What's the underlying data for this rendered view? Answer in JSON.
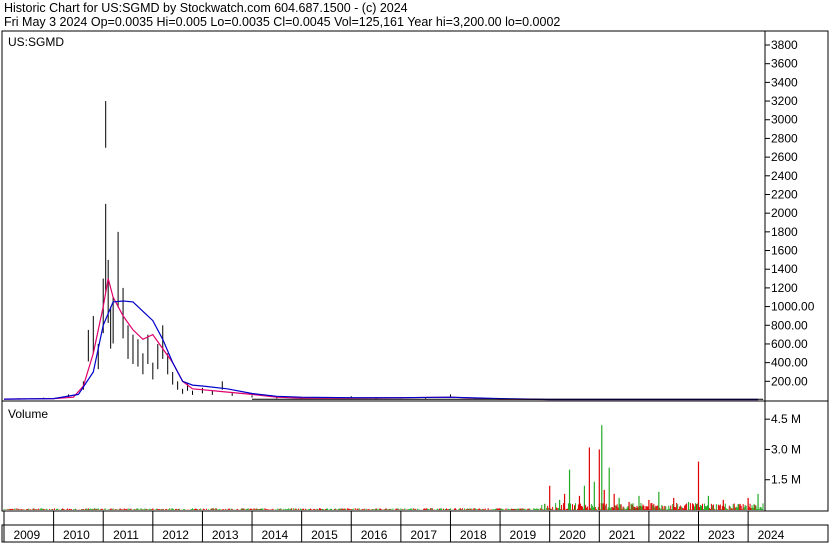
{
  "header": {
    "line1": "Historic Chart for US:SGMD by Stockwatch.com 604.687.1500 - (c) 2024",
    "line2": "Fri May  3 2024   Op=0.0035   Hi=0.005   Lo=0.0035   Cl=0.0045   Vol=125,161   Year hi=3,200.00   lo=0.0002"
  },
  "colors": {
    "price_bar": "#000000",
    "ma_short": "#e0006c",
    "ma_long": "#0000cc",
    "vol_up": "#22aa22",
    "vol_down": "#dd0000",
    "grid": "#000000"
  },
  "chart_data": [
    {
      "type": "line",
      "title": "US:SGMD",
      "ylim": [
        0,
        3950
      ],
      "y_ticks": [
        "3800",
        "3600",
        "3400",
        "3200",
        "3000",
        "2800",
        "2600",
        "2400",
        "2200",
        "2000",
        "1800",
        "1600",
        "1400",
        "1200",
        "1000.00",
        "800.00",
        "600.00",
        "400.00",
        "200.00"
      ],
      "x_ticks": [
        "2009",
        "2010",
        "2011",
        "2012",
        "2013",
        "2014",
        "2015",
        "2016",
        "2017",
        "2018",
        "2019",
        "2020",
        "2021",
        "2022",
        "2023",
        "2024"
      ],
      "grid": false,
      "series": [
        {
          "kind": "price",
          "x": [
            2008.8,
            2009.3,
            2009.8,
            2010.3,
            2010.6,
            2010.7,
            2010.8,
            2010.9,
            2011.0,
            2011.05,
            2011.1,
            2011.15,
            2011.2,
            2011.3,
            2011.4,
            2011.5,
            2011.6,
            2011.7,
            2011.8,
            2011.9,
            2012.0,
            2012.1,
            2012.2,
            2012.3,
            2012.4,
            2012.5,
            2012.6,
            2012.7,
            2012.8,
            2013.0,
            2013.2,
            2013.4,
            2013.6,
            2014.0,
            2014.5,
            2015.0,
            2016.0,
            2016.5,
            2017.0,
            2017.5,
            2018.0,
            2018.5,
            2019.0,
            2020.0,
            2021.0,
            2022.0,
            2023.0,
            2024.3
          ],
          "y": [
            20,
            20,
            25,
            60,
            200,
            750,
            900,
            600,
            1300,
            2100,
            1500,
            1000,
            1100,
            1800,
            1200,
            800,
            700,
            650,
            500,
            700,
            400,
            600,
            800,
            500,
            300,
            200,
            120,
            180,
            100,
            130,
            100,
            200,
            80,
            50,
            30,
            20,
            40,
            20,
            30,
            20,
            60,
            20,
            10,
            5,
            5,
            5,
            5,
            5
          ]
        },
        {
          "kind": "ma_short",
          "x": [
            2009.0,
            2010.0,
            2010.4,
            2010.6,
            2010.8,
            2011.0,
            2011.1,
            2011.2,
            2011.4,
            2011.6,
            2011.8,
            2012.0,
            2012.2,
            2012.4,
            2012.6,
            2012.8,
            2013.0,
            2013.4,
            2014.0,
            2014.5,
            2015.0,
            2016.0,
            2017.0,
            2018.0,
            2019.0,
            2020.0,
            2022.0,
            2024.2
          ],
          "y": [
            10,
            15,
            30,
            150,
            500,
            1000,
            1300,
            1100,
            900,
            750,
            650,
            700,
            550,
            400,
            200,
            120,
            110,
            90,
            60,
            30,
            20,
            20,
            25,
            30,
            10,
            5,
            5,
            5
          ]
        },
        {
          "kind": "ma_long",
          "x": [
            2009.0,
            2010.0,
            2010.5,
            2010.8,
            2011.0,
            2011.2,
            2011.4,
            2011.6,
            2011.8,
            2012.0,
            2012.2,
            2012.4,
            2012.6,
            2012.8,
            2013.0,
            2013.5,
            2014.0,
            2014.5,
            2015.0,
            2016.0,
            2017.0,
            2018.0,
            2019.0,
            2020.0,
            2022.0,
            2024.2
          ],
          "y": [
            10,
            15,
            60,
            300,
            800,
            1050,
            1060,
            1050,
            950,
            850,
            650,
            400,
            200,
            160,
            150,
            120,
            70,
            40,
            30,
            25,
            25,
            30,
            15,
            5,
            5,
            5
          ]
        }
      ]
    },
    {
      "type": "bar",
      "title": "Volume",
      "ylim": [
        0,
        5400000
      ],
      "y_ticks": [
        "4.5 M",
        "3.0 M",
        "1.5 M"
      ],
      "series": [
        {
          "name": "",
          "kind": "volume_spikes",
          "x": [
            2019.9,
            2020.0,
            2020.2,
            2020.3,
            2020.4,
            2020.6,
            2020.7,
            2020.8,
            2020.9,
            2021.0,
            2021.05,
            2021.1,
            2021.2,
            2021.3,
            2021.4,
            2021.6,
            2021.8,
            2022.0,
            2022.2,
            2022.5,
            2022.8,
            2023.0,
            2023.2,
            2023.5,
            2023.8,
            2024.0,
            2024.2
          ],
          "y": [
            300000,
            1200000,
            500000,
            800000,
            2000000,
            700000,
            1200000,
            3100000,
            1400000,
            3000000,
            4200000,
            1000000,
            2100000,
            800000,
            600000,
            400000,
            700000,
            500000,
            900000,
            600000,
            400000,
            2400000,
            700000,
            500000,
            300000,
            600000,
            800000
          ]
        }
      ]
    }
  ]
}
